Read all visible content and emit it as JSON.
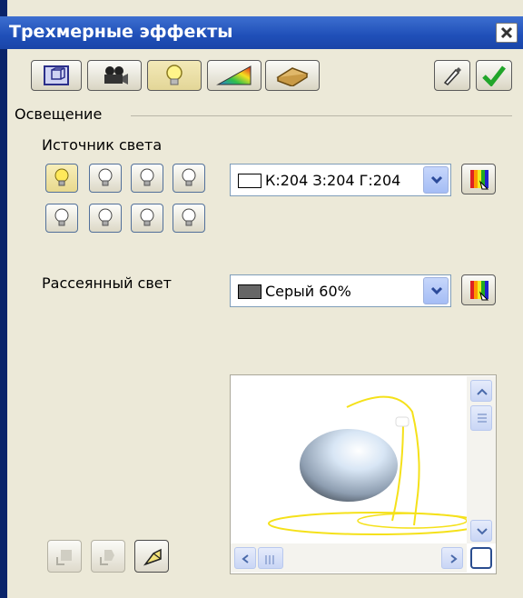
{
  "window": {
    "title": "Трехмерные эффекты"
  },
  "toolbar": {
    "buttons": [
      {
        "name": "geometry",
        "icon": "cube-icon"
      },
      {
        "name": "shading",
        "icon": "camera-icon"
      },
      {
        "name": "illumination",
        "icon": "bulb-icon",
        "active": true
      },
      {
        "name": "textures",
        "icon": "gradient-icon"
      },
      {
        "name": "material",
        "icon": "brick-icon"
      }
    ],
    "right_buttons": [
      {
        "name": "assign",
        "icon": "eyedropper-icon"
      },
      {
        "name": "apply",
        "icon": "check-icon"
      }
    ]
  },
  "illumination": {
    "section_label": "Освещение",
    "light_source_label": "Источник света",
    "light_count": 8,
    "active_light": 1,
    "light_color": {
      "value": "К:204 З:204 Г:204",
      "swatch": "#cccccc"
    },
    "ambient_label": "Рассеянный свет",
    "ambient_color": {
      "value": "Серый 60%",
      "swatch": "#666666"
    }
  },
  "colors": {
    "accent": "#1f4fb8",
    "preview_light_ray": "#f5e11a",
    "sphere": "#a8b8cc"
  }
}
